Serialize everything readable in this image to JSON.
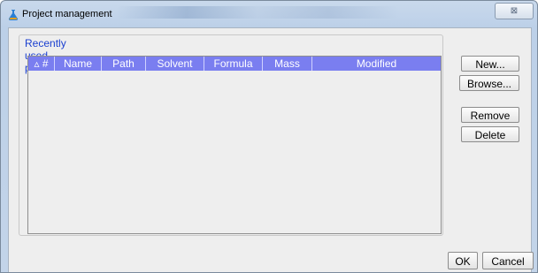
{
  "window": {
    "title": "Project management",
    "close_symbol": "⊠"
  },
  "group": {
    "title": "Recently used projects"
  },
  "table": {
    "columns": [
      "▵ #",
      "Name",
      "Path",
      "Solvent",
      "Formula",
      "Mass",
      "Modified"
    ],
    "rows": []
  },
  "buttons": {
    "new": "New...",
    "browse": "Browse...",
    "remove": "Remove",
    "delete": "Delete",
    "ok": "OK",
    "cancel": "Cancel"
  },
  "colors": {
    "header_bg": "#7a7ef0",
    "title_text": "#1a3fd0"
  }
}
